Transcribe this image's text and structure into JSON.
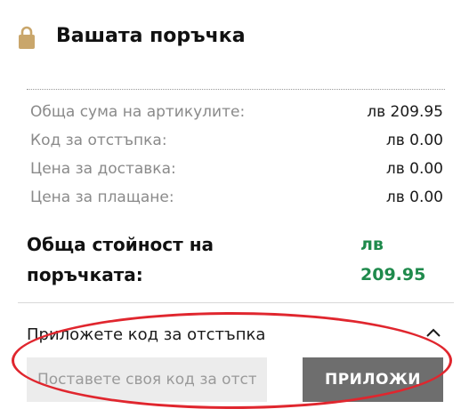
{
  "header": {
    "title": "Вашата поръчка",
    "icon": "lock-icon",
    "icon_color": "#c9a66b"
  },
  "summary": {
    "rows": [
      {
        "label": "Обща сума на артикулите:",
        "value": "лв 209.95"
      },
      {
        "label": "Код за отстъпка:",
        "value": "лв 0.00"
      },
      {
        "label": "Цена за доставка:",
        "value": "лв 0.00"
      },
      {
        "label": "Цена за плащане:",
        "value": "лв 0.00"
      }
    ],
    "total": {
      "label_line1": "Обща стойност на",
      "label_line2": "поръчката:",
      "currency": "лв",
      "amount": "209.95",
      "color": "#1f8a4c"
    }
  },
  "coupon": {
    "toggle_label": "Приложете код за отстъпка",
    "toggle_icon": "chevron-up-icon",
    "placeholder": "Поставете своя код за отстъпка",
    "value": "",
    "apply_label": "ПРИЛОЖИ",
    "highlight_color": "#e0262e"
  }
}
